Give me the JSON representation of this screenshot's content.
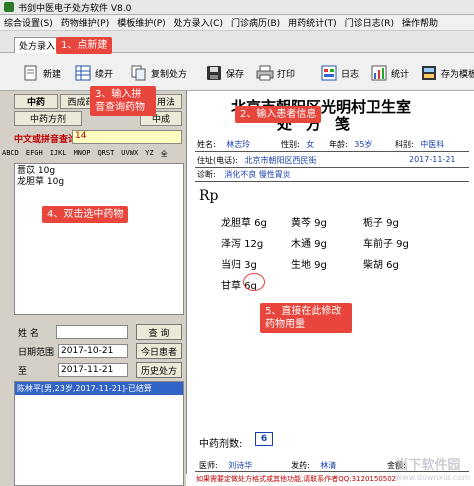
{
  "window": {
    "title": "书剑中医电子处方软件 V8.0"
  },
  "menu": [
    "综合设置(S)",
    "药物维护(P)",
    "模板维护(P)",
    "处方录入(C)",
    "门诊病历(B)",
    "用药统计(T)",
    "门诊日志(R)",
    "操作帮助"
  ],
  "tabs": {
    "active": "处方录入"
  },
  "toolbar": {
    "new": "新建",
    "continue": "续开",
    "copy": "复制处方",
    "save": "保存",
    "print": "打印",
    "log": "日志",
    "stats": "统计",
    "save_template": "存为模板"
  },
  "callouts": {
    "c1": "1、点新建",
    "c2": "2、输入患者信息",
    "c3": "3、输入拼音查询药物",
    "c4": "4、双击选中药物",
    "c5": "5、直接在此修改药物用量"
  },
  "left": {
    "tab_cn": "中药",
    "tab_west": "西成药",
    "tab_method": "用法",
    "tab_rx": "中药方剂",
    "tab_rx2": "中成",
    "search_label": "中文或拼音查询",
    "search_value": "14",
    "alphabet": [
      "ABCD",
      "EFGH",
      "IJKL",
      "MNOP",
      "QRST",
      "UVWX",
      "YZ",
      "全"
    ],
    "herbs": [
      "薏苡 10g",
      "龙胆草 10g"
    ],
    "name_label": "姓  名",
    "name_value": "",
    "query": "查  询",
    "date_label": "日期范围",
    "date_from": "2017-10-21",
    "date_to": "2017-11-21",
    "today_patients": "今日患者",
    "to": "至",
    "history_rx": "历史处方",
    "history_rows": [
      "陈林平[男,23岁,2017-11-21]-已结算"
    ]
  },
  "rx": {
    "clinic": "北京市朝阳区光明村卫生室",
    "heading": "处方笺",
    "name_label": "姓名:",
    "name": "林志玲",
    "sex_label": "性别:",
    "sex": "女",
    "age_label": "年龄:",
    "age": "35岁",
    "dept_label": "科别:",
    "dept": "中医科",
    "addr_label": "住址(电话):",
    "addr": "北京市朝阳区西民街",
    "date": "2017-11-21",
    "diag_label": "诊断:",
    "diag": "消化不良 慢性胃炎",
    "rp": "Rp",
    "herbs": [
      [
        "龙胆草 6g",
        "黄芩 9g",
        "栀子 9g"
      ],
      [
        "泽泻 12g",
        "木通 9g",
        "车前子 9g"
      ],
      [
        "当归 3g",
        "生地 9g",
        "柴胡 6g"
      ],
      [
        "甘草 6g"
      ]
    ],
    "dose_label": "中药剂数:",
    "dose": "6",
    "doctor_label": "医师:",
    "doctor": "刘诗华",
    "pharm_label": "发药:",
    "pharm": "林清",
    "amount_label": "金额:",
    "amount": "",
    "footer": "如果需要定做处方格式或其他功能,请联系作者QQ:3120150502"
  },
  "watermark": {
    "main": "当下软件园",
    "sub": "www.downxia.com"
  },
  "colors": {
    "callout": "#e8453c",
    "value_text": "#1a3fb0",
    "search_bg": "#ffffc0",
    "selection": "#3264c8"
  }
}
